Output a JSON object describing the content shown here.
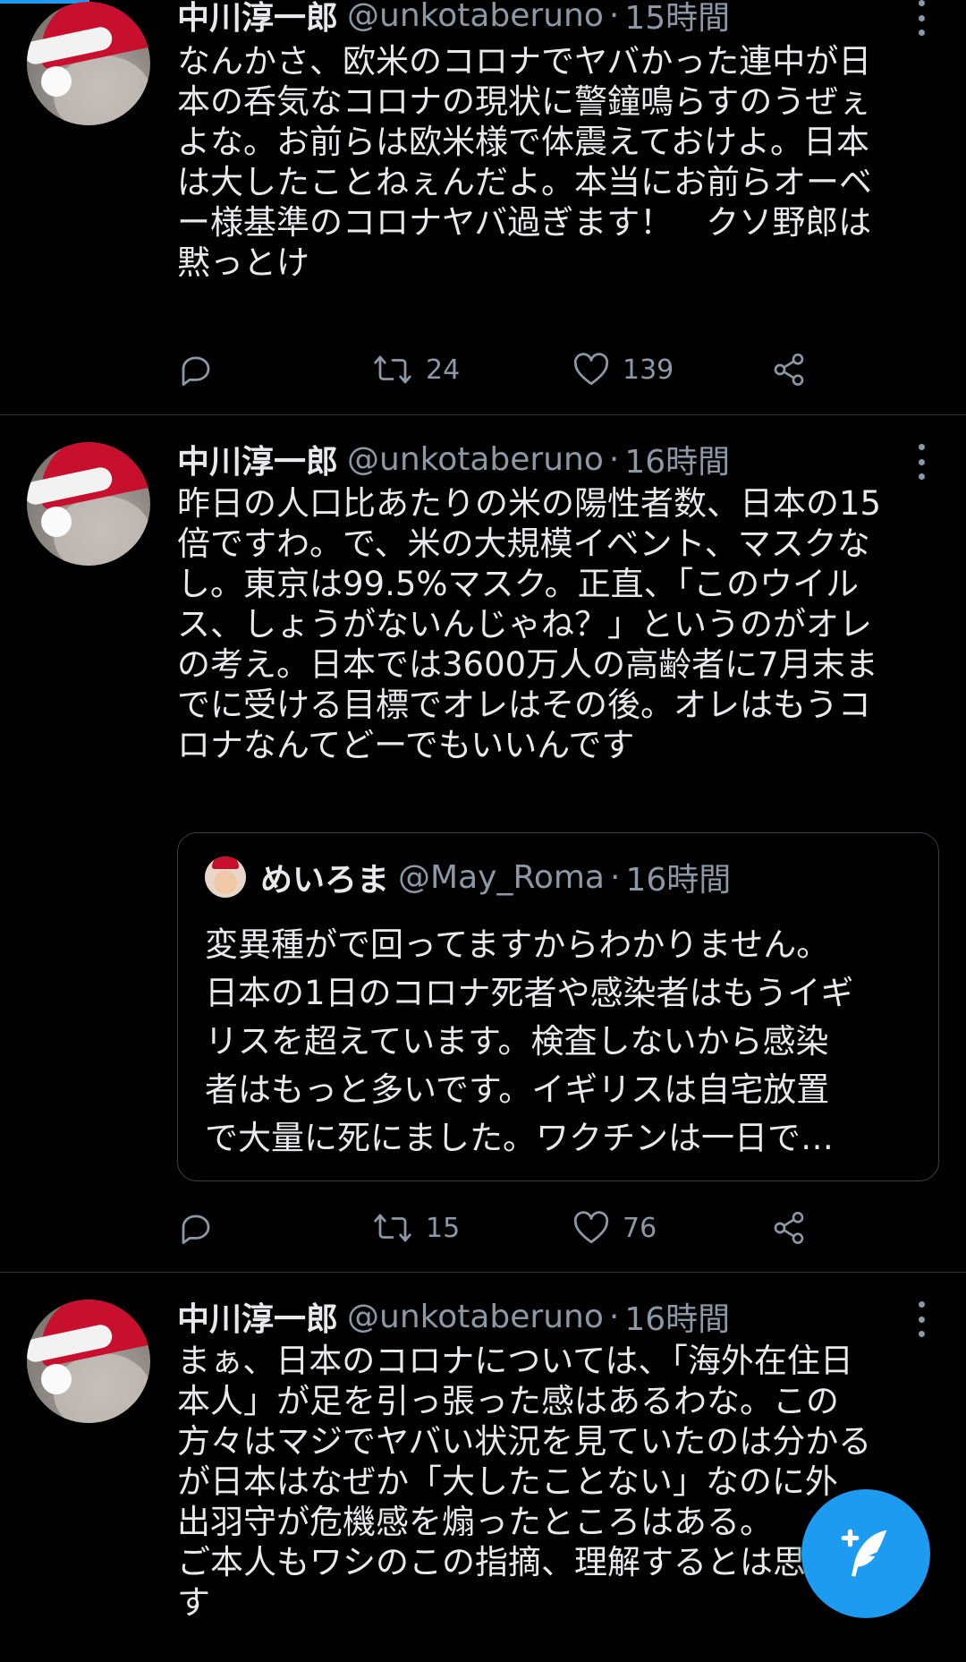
{
  "tweets": [
    {
      "name": "中川淳一郎",
      "handle": "@unkotaberuno",
      "time": "15時間",
      "lines": [
        "なんかさ、欧米のコロナでヤバかった連中が日",
        "本の呑気なコロナの現状に警鐘鳴らすのうぜぇ",
        "よな。お前らは欧米様で体震えておけよ。日本",
        "は大したことねぇんだよ。本当にお前らオーベ",
        "ー様基準のコロナヤバ過ぎます！　クソ野郎は",
        "黙っとけ"
      ],
      "retweets": "24",
      "likes": "139"
    },
    {
      "name": "中川淳一郎",
      "handle": "@unkotaberuno",
      "time": "16時間",
      "lines": [
        "昨日の人口比あたりの米の陽性者数、日本の15",
        "倍ですわ。で、米の大規模イベント、マスクな",
        "し。東京は99.5%マスク。正直、「このウイル",
        "ス、しょうがないんじゃね？」というのがオレ",
        "の考え。日本では3600万人の高齢者に7月末ま",
        "でに受ける目標でオレはその後。オレはもうコ",
        "ロナなんてどーでもいいんです"
      ],
      "quote": {
        "name": "めいろま",
        "handle": "@May_Roma",
        "time": "16時間",
        "lines": [
          "変異種がで回ってますからわかりません。",
          "日本の1日のコロナ死者や感染者はもうイギ",
          "リスを超えています。検査しないから感染",
          "者はもっと多いです。イギリスは自宅放置",
          "で大量に死にました。ワクチンは一日で…"
        ]
      },
      "retweets": "15",
      "likes": "76"
    },
    {
      "name": "中川淳一郎",
      "handle": "@unkotaberuno",
      "time": "16時間",
      "lines": [
        "まぁ、日本のコロナについては、「海外在住日",
        "本人」が足を引っ張った感はあるわな。この",
        "方々はマジでヤバい状況を見ていたのは分かる",
        "が日本はなぜか「大したことない」なのに外",
        "出羽守が危機感を煽ったところはある。",
        "ご本人もワシのこの指摘、理解するとは思いま",
        "す"
      ]
    }
  ],
  "icons": {
    "reply": "reply-icon",
    "retweet": "retweet-icon",
    "like": "heart-icon",
    "share": "share-icon",
    "more": "more-vertical-icon",
    "compose": "compose-tweet-icon"
  },
  "colors": {
    "accent": "#1d9bf0",
    "muted": "#8b98a5",
    "background": "#000000"
  }
}
